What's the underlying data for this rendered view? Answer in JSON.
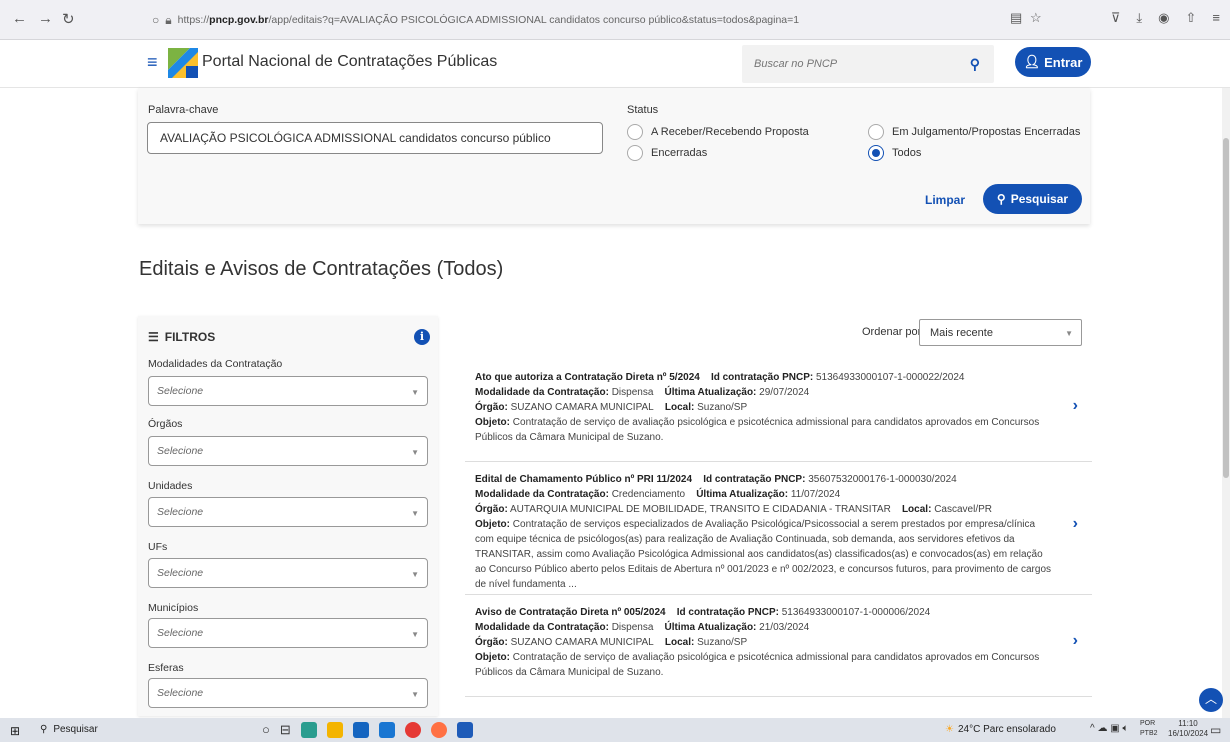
{
  "browser": {
    "url_prefix": "https://",
    "url_domain": "pncp.gov.br",
    "url_path": "/app/editais?q=AVALIAÇÃO PSICOLÓGICA ADMISSIONAL candidatos concurso público&status=todos&pagina=1"
  },
  "header": {
    "title": "Portal Nacional de Contratações Públicas",
    "search_placeholder": "Buscar no PNCP",
    "login_label": "Entrar"
  },
  "filter_panel": {
    "keyword_label": "Palavra-chave",
    "keyword_value": "AVALIAÇÃO PSICOLÓGICA ADMISSIONAL candidatos concurso público",
    "status_label": "Status",
    "status_options": [
      {
        "label": "A Receber/Recebendo Proposta",
        "selected": false
      },
      {
        "label": "Em Julgamento/Propostas Encerradas",
        "selected": false
      },
      {
        "label": "Encerradas",
        "selected": false
      },
      {
        "label": "Todos",
        "selected": true
      }
    ],
    "clear_label": "Limpar",
    "search_label": "Pesquisar"
  },
  "page_title": "Editais e Avisos de Contratações (Todos)",
  "sidebar": {
    "heading": "FILTROS",
    "filters": [
      {
        "label": "Modalidades da Contratação",
        "value": "Selecione"
      },
      {
        "label": "Órgãos",
        "value": "Selecione"
      },
      {
        "label": "Unidades",
        "value": "Selecione"
      },
      {
        "label": "UFs",
        "value": "Selecione"
      },
      {
        "label": "Municípios",
        "value": "Selecione"
      },
      {
        "label": "Esferas",
        "value": "Selecione"
      }
    ]
  },
  "sort": {
    "label": "Ordenar por:",
    "value": "Mais recente"
  },
  "field_labels": {
    "id": "Id contratação PNCP:",
    "modalidade": "Modalidade da Contratação:",
    "atualizacao": "Última Atualização:",
    "orgao": "Órgão:",
    "local": "Local:",
    "objeto": "Objeto:"
  },
  "results": [
    {
      "title": "Ato que autoriza a Contratação Direta nº 5/2024",
      "id": "51364933000107-1-000022/2024",
      "modalidade": "Dispensa",
      "atualizacao": "29/07/2024",
      "orgao": "SUZANO CAMARA MUNICIPAL",
      "local": "Suzano/SP",
      "objeto": "Contratação de serviço de avaliação psicológica e psicotécnica admissional para candidatos aprovados em Concursos Públicos da Câmara Municipal de Suzano."
    },
    {
      "title": "Edital de Chamamento Público nº PRI 11/2024",
      "id": "35607532000176-1-000030/2024",
      "modalidade": "Credenciamento",
      "atualizacao": "11/07/2024",
      "orgao": "AUTARQUIA MUNICIPAL DE MOBILIDADE, TRANSITO E CIDADANIA - TRANSITAR",
      "local": "Cascavel/PR",
      "objeto": "Contratação de serviços especializados de Avaliação Psicológica/Psicossocial a serem prestados por empresa/clínica com equipe técnica de psicólogos(as) para realização de Avaliação Continuada, sob demanda, aos servidores efetivos da TRANSITAR, assim como Avaliação Psicológica Admissional aos candidatos(as) classificados(as) e convocados(as) em relação ao Concurso Público aberto pelos Editais de Abertura nº 001/2023 e nº 002/2023, e concursos futuros, para provimento de cargos de nível fundamenta ..."
    },
    {
      "title": "Aviso de Contratação Direta nº 005/2024",
      "id": "51364933000107-1-000006/2024",
      "modalidade": "Dispensa",
      "atualizacao": "21/03/2024",
      "orgao": "SUZANO CAMARA MUNICIPAL",
      "local": "Suzano/SP",
      "objeto": "Contratação de serviço de avaliação psicológica e psicotécnica admissional para candidatos aprovados em Concursos Públicos da Câmara Municipal de Suzano."
    }
  ],
  "taskbar": {
    "search_label": "Pesquisar",
    "weather": "24°C  Parc ensolarado",
    "lang_1": "POR",
    "lang_2": "PTB2",
    "time": "11:10",
    "date": "16/10/2024"
  },
  "colors": {
    "primary": "#1351b4",
    "panel_bg": "#f8f8f8"
  }
}
